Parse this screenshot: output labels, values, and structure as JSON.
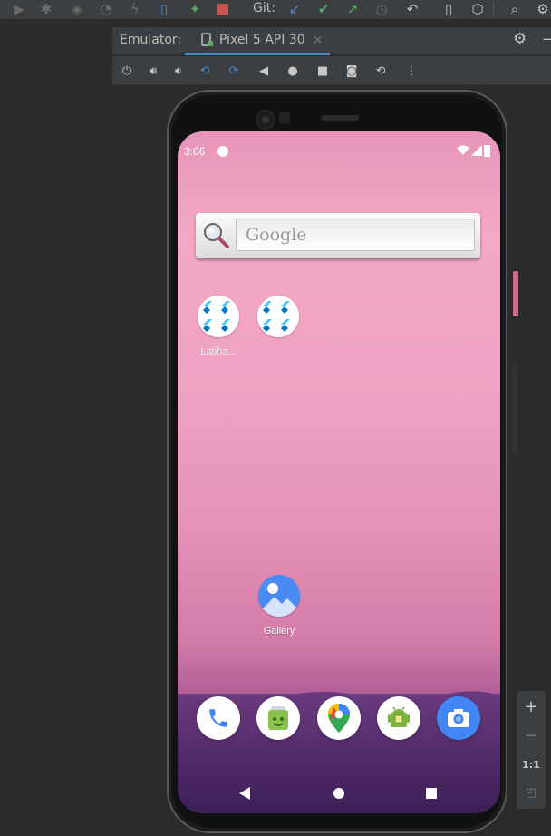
{
  "ide": {
    "git_label": "Git:",
    "toolbar_icons": [
      "run-icon",
      "debug-icon",
      "coverage-icon",
      "profiler-icon",
      "apply-changes-icon",
      "device-manager-icon",
      "stop-icon"
    ]
  },
  "emulator": {
    "title": "Emulator:",
    "tab_label": "Pixel 5 API 30",
    "tab_close": "×",
    "zoom": {
      "plus": "+",
      "minus": "−",
      "one_to_one": "1:1"
    }
  },
  "device": {
    "status_time": "3:06",
    "google_placeholder": "Google",
    "apps": [
      {
        "label": "Latiha..."
      },
      {
        "label": ""
      },
      {
        "label": "Gallery"
      }
    ],
    "dock": [
      "phone-icon",
      "messaging-icon",
      "maps-icon",
      "play-store-icon",
      "camera-icon"
    ]
  },
  "colors": {
    "ide_bg": "#2b2b2b",
    "ide_toolbar": "#3c3f41",
    "accent_tab": "#4a88c7",
    "wallpaper_pink": "#f3a8c6",
    "wallpaper_purple": "#4f2a6a"
  }
}
